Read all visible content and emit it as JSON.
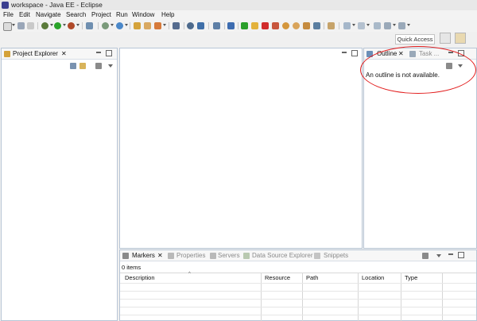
{
  "window": {
    "title": "workspace - Java EE - Eclipse"
  },
  "menu": [
    "File",
    "Edit",
    "Navigate",
    "Search",
    "Project",
    "Run",
    "Window",
    "Help"
  ],
  "toolbar": {
    "icons": [
      "new-icon",
      "save-icon",
      "print-icon",
      "debug-icon",
      "run-icon",
      "run-external-icon",
      "new-server-icon",
      "open-type-icon",
      "open-task-icon",
      "open-folder-icon",
      "search-icon",
      "back-icon",
      "forward-icon",
      "pin-icon",
      "monitor-icon",
      "cursor-icon",
      "resume-icon",
      "suspend-icon",
      "terminate-icon",
      "disconnect-icon",
      "step-into-icon",
      "step-over-icon",
      "step-return-icon",
      "drop-frame-icon",
      "use-step-filters-icon",
      "annotation-icon",
      "history-icon",
      "nav-back-icon",
      "nav-forward-icon"
    ]
  },
  "quick_access": {
    "label": "Quick Access"
  },
  "project_explorer": {
    "tab_label": "Project Explorer",
    "close_glyph": "✕"
  },
  "outline": {
    "tab_label": "Outline",
    "tab2_label": "Task ...",
    "close_glyph": "✕",
    "message": "An outline is not available."
  },
  "bottom": {
    "tabs": [
      {
        "label": "Markers",
        "active": true
      },
      {
        "label": "Properties",
        "active": false
      },
      {
        "label": "Servers",
        "active": false
      },
      {
        "label": "Data Source Explorer",
        "active": false
      },
      {
        "label": "Snippets",
        "active": false
      }
    ],
    "close_glyph": "✕",
    "items_count": "0 items",
    "columns": [
      "Description",
      "Resource",
      "Path",
      "Location",
      "Type"
    ]
  },
  "colors": {
    "callout": "#e21c1c",
    "panel_border": "#b8c6d6"
  }
}
